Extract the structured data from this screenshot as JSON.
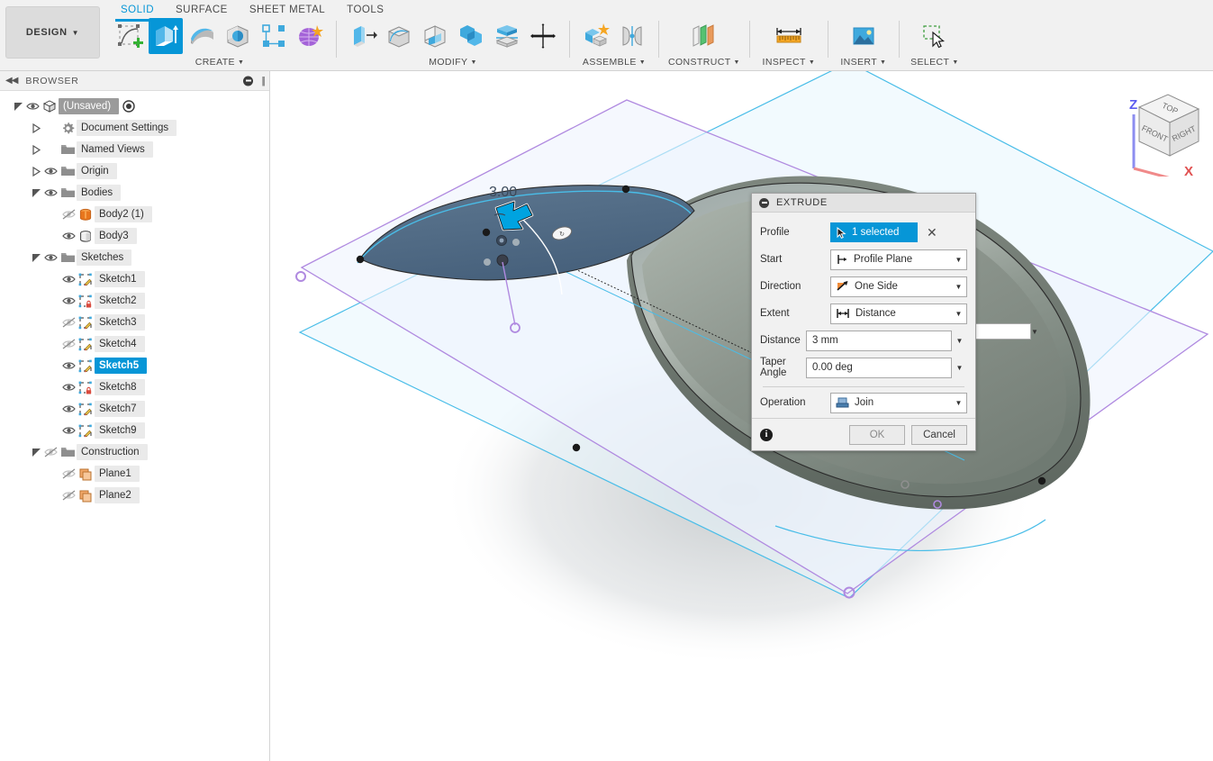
{
  "app": {
    "workspace_label": "DESIGN",
    "accent_blue": "#0696d7"
  },
  "tabs": [
    {
      "label": "SOLID",
      "active": true
    },
    {
      "label": "SURFACE",
      "active": false
    },
    {
      "label": "SHEET METAL",
      "active": false
    },
    {
      "label": "TOOLS",
      "active": false
    }
  ],
  "ribbon": {
    "groups": [
      {
        "label": "CREATE",
        "has_caret": true,
        "icons": [
          {
            "name": "create-sketch-icon"
          },
          {
            "name": "extrude-icon",
            "active": true
          },
          {
            "name": "revolve-icon"
          },
          {
            "name": "sweep-icon"
          },
          {
            "name": "pattern-icon"
          },
          {
            "name": "form-icon"
          }
        ]
      },
      {
        "label": "MODIFY",
        "has_caret": true,
        "icons": [
          {
            "name": "press-pull-icon"
          },
          {
            "name": "fillet-icon"
          },
          {
            "name": "shell-icon"
          },
          {
            "name": "combine-icon"
          },
          {
            "name": "split-face-icon"
          },
          {
            "name": "move-copy-icon"
          }
        ]
      },
      {
        "label": "ASSEMBLE",
        "has_caret": true,
        "icons": [
          {
            "name": "new-component-icon"
          },
          {
            "name": "joint-icon"
          }
        ]
      },
      {
        "label": "CONSTRUCT",
        "has_caret": true,
        "icons": [
          {
            "name": "offset-plane-icon"
          }
        ]
      },
      {
        "label": "INSPECT",
        "has_caret": true,
        "icons": [
          {
            "name": "measure-icon"
          }
        ]
      },
      {
        "label": "INSERT",
        "has_caret": true,
        "icons": [
          {
            "name": "insert-image-icon"
          }
        ]
      },
      {
        "label": "SELECT",
        "has_caret": true,
        "icons": [
          {
            "name": "select-window-icon"
          }
        ]
      }
    ]
  },
  "browser": {
    "title": "BROWSER",
    "collapse_icon": "collapse-left-icon",
    "minimize_icon": "minimize-icon",
    "grip_icon": "grip-icon",
    "tree": [
      {
        "label": "(Unsaved)",
        "depth": 0,
        "arrow": "expanded",
        "eye": "visible",
        "icon": "document-icon",
        "root": true,
        "radio": true
      },
      {
        "label": "Document Settings",
        "depth": 1,
        "arrow": "collapsed",
        "eye": "none",
        "icon": "gear-icon"
      },
      {
        "label": "Named Views",
        "depth": 1,
        "arrow": "collapsed",
        "eye": "none",
        "icon": "folder-icon"
      },
      {
        "label": "Origin",
        "depth": 1,
        "arrow": "collapsed",
        "eye": "visible",
        "icon": "folder-icon"
      },
      {
        "label": "Bodies",
        "depth": 1,
        "arrow": "expanded",
        "eye": "visible",
        "icon": "folder-icon"
      },
      {
        "label": "Body2 (1)",
        "depth": 2,
        "arrow": "none",
        "eye": "hidden",
        "icon": "body-orange-icon"
      },
      {
        "label": "Body3",
        "depth": 2,
        "arrow": "none",
        "eye": "visible",
        "icon": "body-gray-icon"
      },
      {
        "label": "Sketches",
        "depth": 1,
        "arrow": "expanded",
        "eye": "visible",
        "icon": "folder-sketch-icon"
      },
      {
        "label": "Sketch1",
        "depth": 2,
        "arrow": "none",
        "eye": "visible",
        "icon": "sketch-icon"
      },
      {
        "label": "Sketch2",
        "depth": 2,
        "arrow": "none",
        "eye": "visible",
        "icon": "sketch-locked-icon"
      },
      {
        "label": "Sketch3",
        "depth": 2,
        "arrow": "none",
        "eye": "hidden",
        "icon": "sketch-icon"
      },
      {
        "label": "Sketch4",
        "depth": 2,
        "arrow": "none",
        "eye": "hidden",
        "icon": "sketch-icon"
      },
      {
        "label": "Sketch5",
        "depth": 2,
        "arrow": "none",
        "eye": "visible",
        "icon": "sketch-icon",
        "selected": true
      },
      {
        "label": "Sketch8",
        "depth": 2,
        "arrow": "none",
        "eye": "visible",
        "icon": "sketch-locked-icon"
      },
      {
        "label": "Sketch7",
        "depth": 2,
        "arrow": "none",
        "eye": "visible",
        "icon": "sketch-icon"
      },
      {
        "label": "Sketch9",
        "depth": 2,
        "arrow": "none",
        "eye": "visible",
        "icon": "sketch-icon"
      },
      {
        "label": "Construction",
        "depth": 1,
        "arrow": "expanded",
        "eye": "hidden",
        "icon": "folder-icon"
      },
      {
        "label": "Plane1",
        "depth": 2,
        "arrow": "none",
        "eye": "hidden",
        "icon": "plane-icon"
      },
      {
        "label": "Plane2",
        "depth": 2,
        "arrow": "none",
        "eye": "hidden",
        "icon": "plane-icon"
      }
    ]
  },
  "canvas": {
    "dimension_label": "3.00",
    "value_input": {
      "value": "3 mm",
      "caret": "dropdown-caret"
    },
    "viewcube": {
      "top_face": "TOP",
      "front_face": "FRONT",
      "right_face": "RIGHT",
      "axis_z": "Z",
      "axis_x": "X"
    }
  },
  "dialog": {
    "title": "EXTRUDE",
    "profile": {
      "label": "Profile",
      "selection_text": "1 selected",
      "clear_label": "✕"
    },
    "start": {
      "label": "Start",
      "value": "Profile Plane",
      "icon": "profile-plane-icon"
    },
    "direction": {
      "label": "Direction",
      "value": "One Side",
      "icon": "one-side-icon"
    },
    "extent": {
      "label": "Extent",
      "value": "Distance",
      "icon": "distance-icon"
    },
    "distance": {
      "label": "Distance",
      "value": "3 mm"
    },
    "taper_angle": {
      "label": "Taper Angle",
      "value": "0.00 deg"
    },
    "operation": {
      "label": "Operation",
      "value": "Join",
      "icon": "join-icon"
    },
    "info_icon": "info-icon",
    "ok_label": "OK",
    "cancel_label": "Cancel"
  }
}
